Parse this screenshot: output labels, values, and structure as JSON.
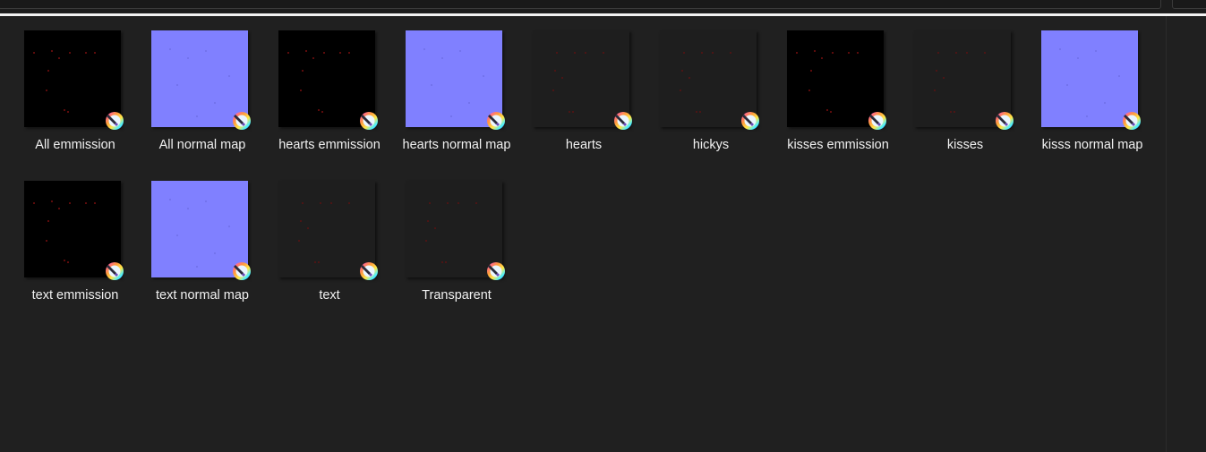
{
  "files": [
    {
      "name": "All emmission",
      "type": "black",
      "icon": "krita-file-icon"
    },
    {
      "name": "All normal map",
      "type": "blue",
      "icon": "krita-file-icon"
    },
    {
      "name": "hearts emmission",
      "type": "black",
      "icon": "krita-file-icon"
    },
    {
      "name": "hearts normal map",
      "type": "blue",
      "icon": "krita-file-icon"
    },
    {
      "name": "hearts",
      "type": "clear",
      "icon": "krita-file-icon"
    },
    {
      "name": "hickys",
      "type": "clear",
      "icon": "krita-file-icon"
    },
    {
      "name": "kisses emmission",
      "type": "black",
      "icon": "krita-file-icon"
    },
    {
      "name": "kisses",
      "type": "clear",
      "icon": "krita-file-icon"
    },
    {
      "name": "kisss normal map",
      "type": "blue",
      "icon": "krita-file-icon"
    },
    {
      "name": "text emmission",
      "type": "black",
      "icon": "krita-file-icon"
    },
    {
      "name": "text normal map",
      "type": "blue",
      "icon": "krita-file-icon"
    },
    {
      "name": "text",
      "type": "clear",
      "icon": "krita-file-icon"
    },
    {
      "name": "Transparent",
      "type": "clear",
      "icon": "krita-file-icon"
    }
  ],
  "colors": {
    "background": "#202020",
    "normal_map": "#8080ff",
    "emission": "#000000",
    "label": "#f0f0f0"
  }
}
